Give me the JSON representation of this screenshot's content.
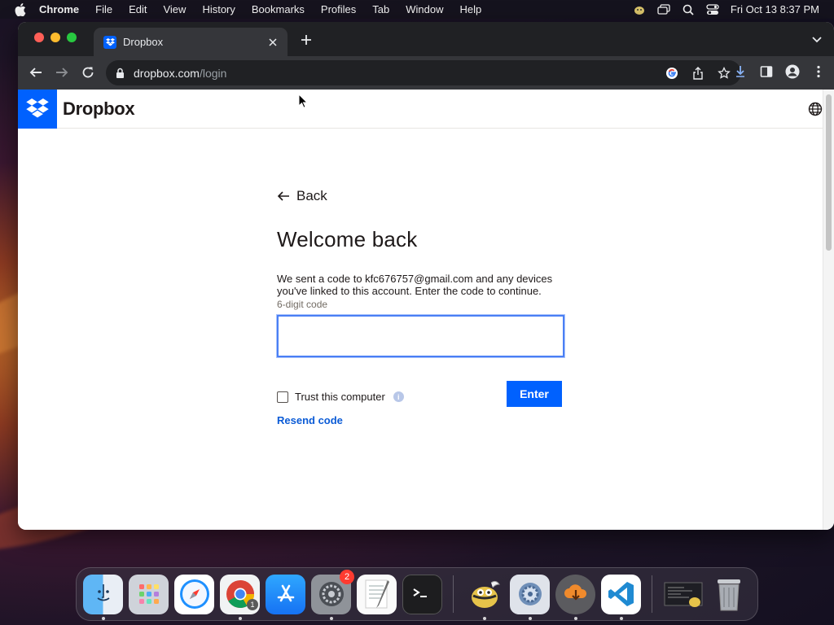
{
  "menubar": {
    "app_name": "Chrome",
    "items": [
      "File",
      "Edit",
      "View",
      "History",
      "Bookmarks",
      "Profiles",
      "Tab",
      "Window",
      "Help"
    ],
    "clock": "Fri Oct 13  8:37 PM"
  },
  "browser": {
    "tab_title": "Dropbox",
    "url_host": "dropbox.com",
    "url_path": "/login"
  },
  "site": {
    "brand": "Dropbox"
  },
  "form": {
    "back_label": "Back",
    "heading": "Welcome back",
    "description": "We sent a code to kfc676757@gmail.com and any devices you've linked to this account. Enter the code to continue.",
    "code_label": "6-digit code",
    "code_value": "",
    "trust_label": "Trust this computer",
    "trust_checked": false,
    "enter_label": "Enter",
    "resend_label": "Resend code"
  },
  "dock": {
    "apps": [
      "finder",
      "launchpad",
      "safari",
      "chrome",
      "app-store",
      "system-settings",
      "textedit",
      "terminal",
      "cyberduck",
      "preferences",
      "downloader",
      "vscode",
      "screenshot-preview",
      "trash"
    ],
    "chrome_badge": "1",
    "settings_badge": "2"
  },
  "colors": {
    "dropbox_blue": "#0061fe",
    "focus_ring": "#4a7ff5",
    "link": "#0b5bd6"
  }
}
